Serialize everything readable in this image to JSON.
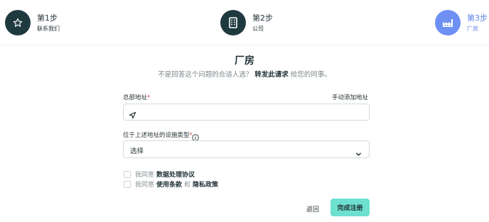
{
  "colors": {
    "step_done": "#1f3a3e",
    "step_active": "#6e90f2",
    "step_active_text": "#5e81e8",
    "primary_button": "#6de0cf",
    "required_mark": "#d9534f"
  },
  "stepper": {
    "steps": [
      {
        "title": "第1步",
        "subtitle": "联系我们",
        "icon": "star-icon",
        "state": "done"
      },
      {
        "title": "第2步",
        "subtitle": "公司",
        "icon": "building-icon",
        "state": "done"
      },
      {
        "title": "第3步",
        "subtitle": "厂房",
        "icon": "factory-icon",
        "state": "active"
      }
    ]
  },
  "page": {
    "title": "厂房",
    "subtitle_prefix": "不是回答这个问题的合适人选？",
    "forward_link": "转发此请求",
    "subtitle_suffix": "给您的同事。"
  },
  "form": {
    "hq_address": {
      "label": "总部地址",
      "required_mark": "*",
      "value": "",
      "icon": "navigation-arrow-icon"
    },
    "manual_add_link": "手动添加地址",
    "facility_type": {
      "label": "位于上述地址的设施类型",
      "required_mark": "*",
      "selected": "选择",
      "info_icon": "info-icon"
    },
    "agreements": [
      {
        "prefix": "我同意",
        "links": [
          "数据处理协议"
        ],
        "checked": false
      },
      {
        "prefix": "我同意",
        "links": [
          "使用条款",
          "隐私政策"
        ],
        "conjunction": "和",
        "checked": false
      }
    ]
  },
  "actions": {
    "back_label": "返回",
    "submit_label": "完成注册"
  }
}
